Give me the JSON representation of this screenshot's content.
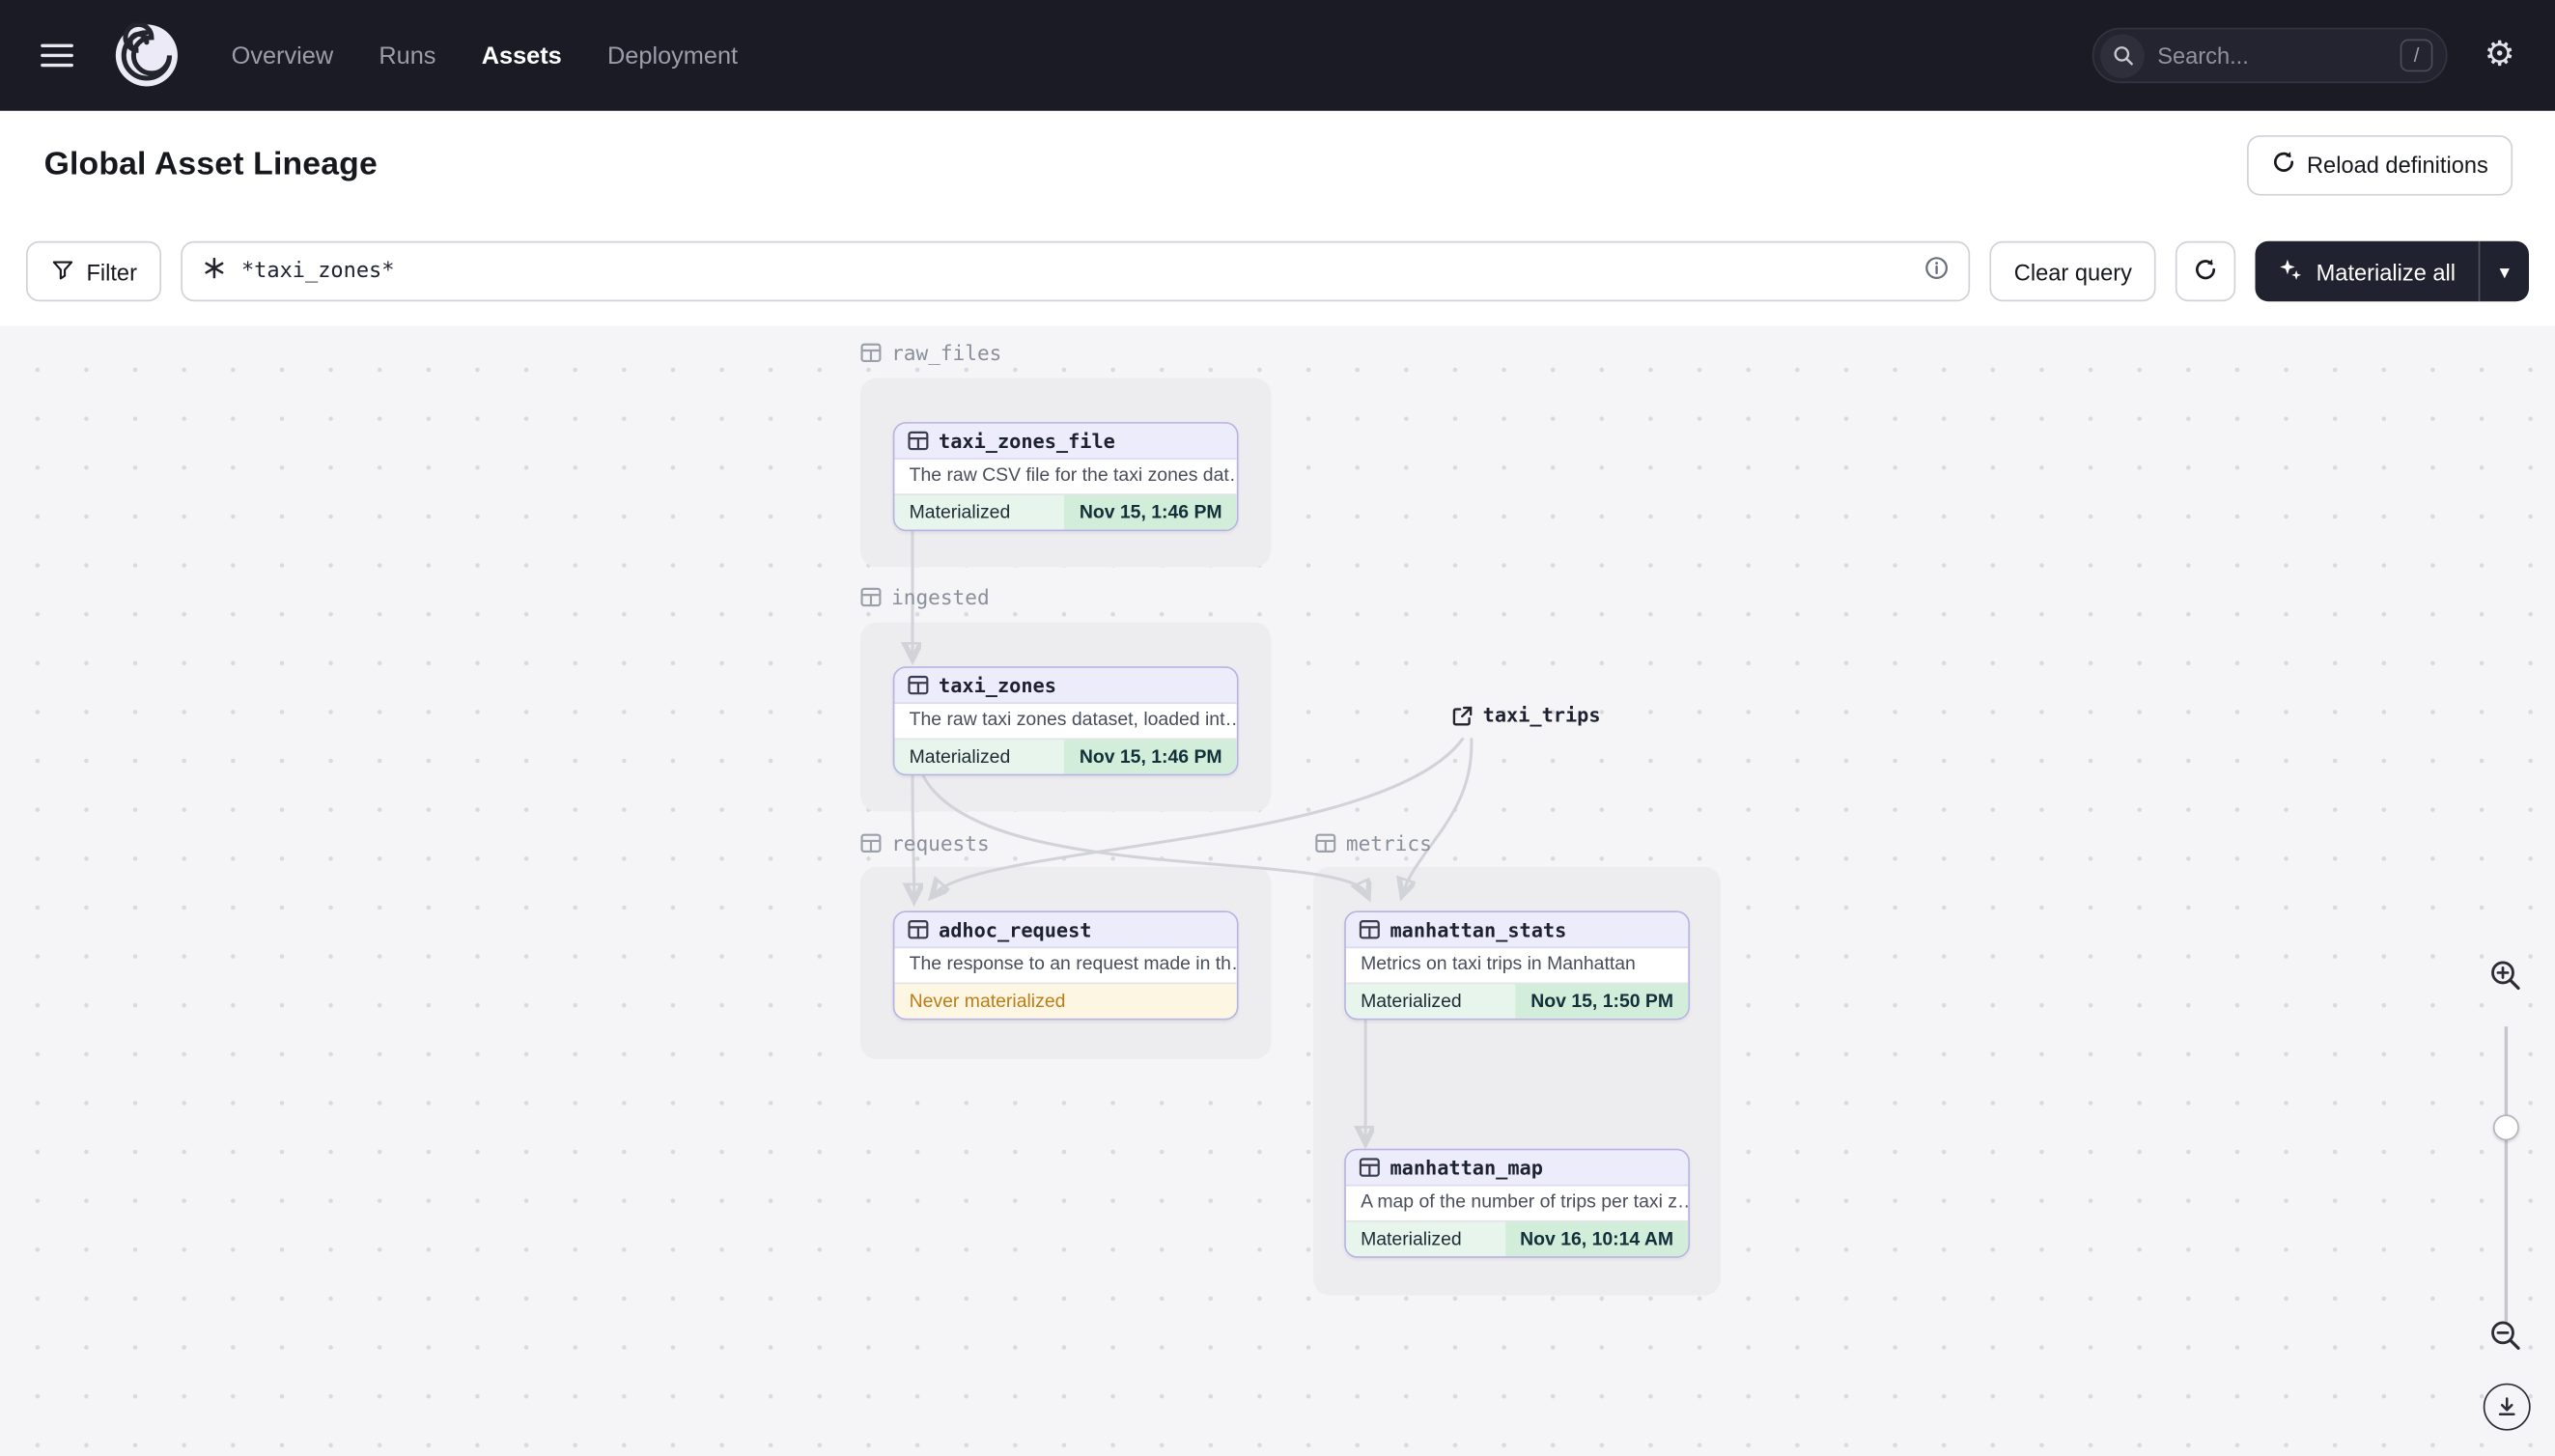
{
  "nav": {
    "items": [
      {
        "label": "Overview",
        "active": false
      },
      {
        "label": "Runs",
        "active": false
      },
      {
        "label": "Assets",
        "active": true
      },
      {
        "label": "Deployment",
        "active": false
      }
    ],
    "search": {
      "placeholder": "Search...",
      "shortcut": "/"
    }
  },
  "header": {
    "title": "Global Asset Lineage",
    "reload_button": "Reload definitions"
  },
  "toolbar": {
    "filter_label": "Filter",
    "query_value": "*taxi_zones*",
    "clear_label": "Clear query",
    "materialize_label": "Materialize all"
  },
  "graph": {
    "groups": [
      {
        "name": "raw_files"
      },
      {
        "name": "ingested"
      },
      {
        "name": "requests"
      },
      {
        "name": "metrics"
      }
    ],
    "nodes": [
      {
        "name": "taxi_zones_file",
        "description": "The raw CSV file for the taxi zones dat…",
        "status_label": "Materialized",
        "timestamp": "Nov 15, 1:46 PM",
        "group": "raw_files"
      },
      {
        "name": "taxi_zones",
        "description": "The raw taxi zones dataset, loaded int…",
        "status_label": "Materialized",
        "timestamp": "Nov 15, 1:46 PM",
        "group": "ingested"
      },
      {
        "name": "adhoc_request",
        "description": "The response to an request made in th…",
        "status_label": "Never materialized",
        "timestamp": "",
        "group": "requests"
      },
      {
        "name": "manhattan_stats",
        "description": "Metrics on taxi trips in Manhattan",
        "status_label": "Materialized",
        "timestamp": "Nov 15, 1:50 PM",
        "group": "metrics"
      },
      {
        "name": "manhattan_map",
        "description": "A map of the number of trips per taxi z…",
        "status_label": "Materialized",
        "timestamp": "Nov 16, 10:14 AM",
        "group": "metrics"
      }
    ],
    "external_node": {
      "name": "taxi_trips"
    },
    "edges": [
      [
        "taxi_zones_file",
        "taxi_zones"
      ],
      [
        "taxi_zones",
        "adhoc_request"
      ],
      [
        "taxi_zones",
        "manhattan_stats"
      ],
      [
        "taxi_trips",
        "adhoc_request"
      ],
      [
        "taxi_trips",
        "manhattan_stats"
      ],
      [
        "manhattan_stats",
        "manhattan_map"
      ]
    ]
  },
  "colors": {
    "nav-bg": "#1a1b25",
    "dark-btn-bg": "#20222f",
    "node-border": "#b7b3e2",
    "node-header-bg": "#ececfa",
    "materialized-bg": "#e7f5ec",
    "materialized-chip-bg": "#d2edda",
    "never-bg": "#fcf6e3",
    "never-text": "#bf7c16",
    "group-bg": "#ededf0",
    "edge": "#d2d3d9"
  }
}
